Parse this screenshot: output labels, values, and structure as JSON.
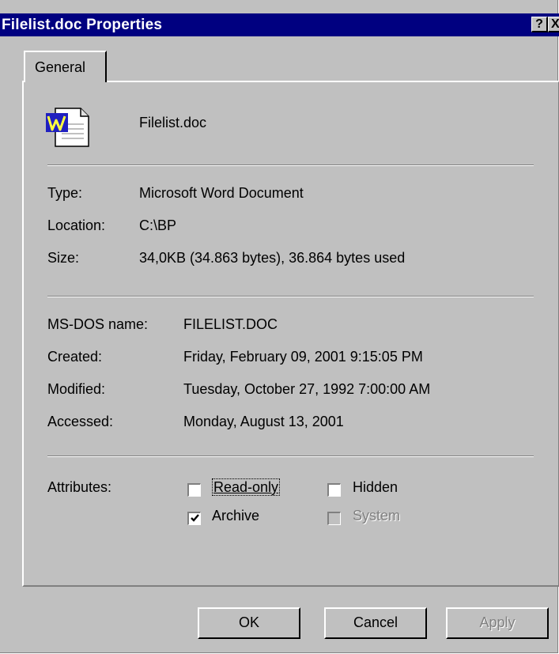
{
  "window": {
    "title": "Filelist.doc Properties",
    "help_label": "?",
    "close_label": "X"
  },
  "tabs": [
    {
      "label": "General",
      "selected": true
    }
  ],
  "file": {
    "name": "Filelist.doc",
    "icon": "word-document-icon"
  },
  "details": {
    "type_label": "Type:",
    "type_value": "Microsoft Word Document",
    "location_label": "Location:",
    "location_value": "C:\\BP",
    "size_label": "Size:",
    "size_value": "34,0KB (34.863 bytes), 36.864 bytes used"
  },
  "dates": {
    "msdos_label": "MS-DOS name:",
    "msdos_value": "FILELIST.DOC",
    "created_label": "Created:",
    "created_value": "Friday, February 09, 2001 9:15:05 PM",
    "modified_label": "Modified:",
    "modified_value": "Tuesday, October 27, 1992 7:00:00 AM",
    "accessed_label": "Accessed:",
    "accessed_value": "Monday, August 13, 2001"
  },
  "attributes": {
    "label": "Attributes:",
    "readonly": {
      "label": "Read-only",
      "checked": false,
      "enabled": true
    },
    "hidden": {
      "label": "Hidden",
      "checked": false,
      "enabled": true
    },
    "archive": {
      "label": "Archive",
      "checked": true,
      "enabled": true
    },
    "system": {
      "label": "System",
      "checked": false,
      "enabled": false
    }
  },
  "buttons": {
    "ok": "OK",
    "cancel": "Cancel",
    "apply": "Apply"
  },
  "colors": {
    "titlebar": "#000080",
    "face": "#c0c0c0"
  }
}
